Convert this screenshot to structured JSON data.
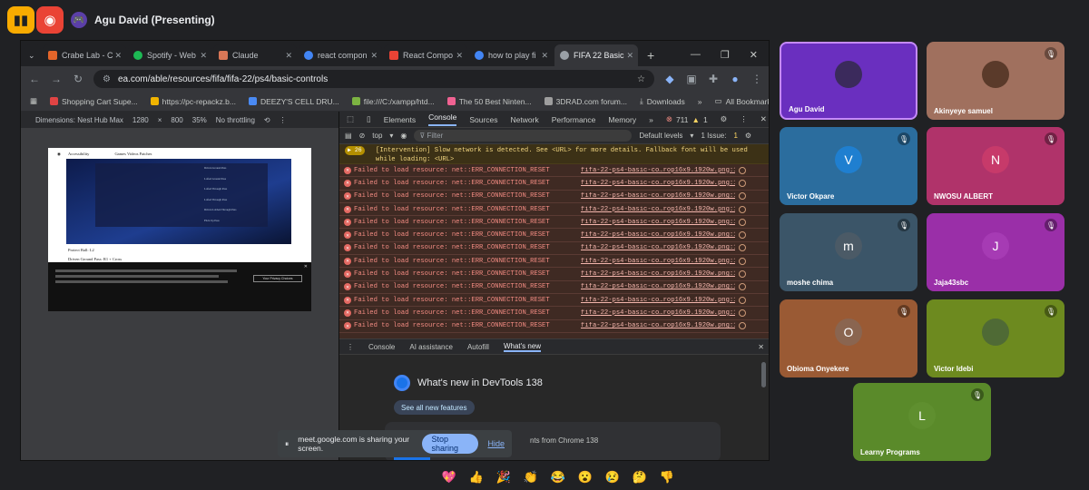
{
  "meet_top": {
    "presenter": "Agu David (Presenting)",
    "left_icon": "meet-panel-icon",
    "record_icon": "record-icon"
  },
  "browser": {
    "tabs": [
      {
        "label": "Crabe Lab - C",
        "color": "#e3652a"
      },
      {
        "label": "Spotify - Web",
        "color": "#1db954"
      },
      {
        "label": "Claude",
        "color": "#d97757"
      },
      {
        "label": "react compon",
        "color": "#4285f4"
      },
      {
        "label": "React Compo",
        "color": "#ea4335"
      },
      {
        "label": "how to play fi",
        "color": "#4285f4"
      },
      {
        "label": "FIFA 22 Basic",
        "color": "#9aa0a6"
      }
    ],
    "url": "ea.com/able/resources/fifa/fifa-22/ps4/basic-controls",
    "bookmarks": [
      {
        "label": "Shopping Cart Supe...",
        "color": "#e04444"
      },
      {
        "label": "https://pc-repackz.b...",
        "color": "#f0b400"
      },
      {
        "label": "DEEZY'S CELL DRU...",
        "color": "#4a8af4"
      },
      {
        "label": "file:///C:/xampp/htd...",
        "color": "#7cb342"
      },
      {
        "label": "The 50 Best Ninten...",
        "color": "#f06292"
      },
      {
        "label": "3DRAD.com forum...",
        "color": "#9e9e9e"
      },
      {
        "label": "Downloads",
        "color": "#9aa0a6"
      }
    ],
    "all_bookmarks": "All Bookmarks"
  },
  "device_toolbar": {
    "dimensions": "Dimensions: Nest Hub Max",
    "width": "1280",
    "height": "800",
    "zoom": "35%",
    "throttle": "No throttling"
  },
  "page_preview": {
    "site_label": "Accessibility",
    "nav": "Games   Videos   Patches",
    "lines": [
      "Protect Ball: L2",
      "Driven Ground Pass: R1 + Cross",
      "Lofted Ground Pass: Cross + Cross",
      "Lofted Through Pass: Triangle + Triangle"
    ],
    "banner_rows": [
      "Driven Ground Pass",
      "Lofted Ground Pass",
      "Lofted Through Pass",
      "Lofted Through Pass",
      "Driven Lobbed Through Pass",
      "Flick Up Pass"
    ],
    "cookie_button": "Your Privacy Choices"
  },
  "devtools": {
    "tabs": [
      "Elements",
      "Console",
      "Sources",
      "Network",
      "Performance",
      "Memory"
    ],
    "active_tab": "Console",
    "error_count": "711",
    "warn_count": "1",
    "context": "top",
    "filter_placeholder": "Filter",
    "levels": "Default levels",
    "issues": "1 Issue:",
    "issues_count": "1",
    "warning": {
      "count": "26",
      "line1": "[Intervention] Slow network is detected. See <URL> for more details. Fallback font will be used",
      "line2": "while loading: <URL>"
    },
    "error_message": "Failed to load resource: net::ERR_CONNECTION_RESET",
    "error_source": "fifa-22-ps4-basic-co…rop16x9.1920w.png:1",
    "drawer_tabs": [
      "Console",
      "AI assistance",
      "Autofill",
      "What's new"
    ],
    "whats_new_title": "What's new in DevTools 138",
    "see_all": "See all new features",
    "card_text": "nts from Chrome 138"
  },
  "sharing": {
    "notice": "meet.google.com is sharing your screen.",
    "stop": "Stop sharing",
    "hide": "Hide"
  },
  "participants": [
    {
      "name": "Agu David",
      "initial": "",
      "bg": "#6a2fbf",
      "av": "#3b2a5c",
      "muted": false
    },
    {
      "name": "Akinyeye samuel",
      "initial": "",
      "bg": "#a0705e",
      "av": "#5a3a2a",
      "muted": true
    },
    {
      "name": "Victor Okpare",
      "initial": "V",
      "bg": "#2b6d9e",
      "av": "#1f7fd0",
      "muted": true
    },
    {
      "name": "NWOSU ALBERT",
      "initial": "N",
      "bg": "#b0336a",
      "av": "#c73a6a",
      "muted": true
    },
    {
      "name": "moshe chima",
      "initial": "m",
      "bg": "#3b5568",
      "av": "#4b5a66",
      "muted": true
    },
    {
      "name": "Jaja43sbc",
      "initial": "J",
      "bg": "#9a2fa8",
      "av": "#a63bb4",
      "muted": true
    },
    {
      "name": "Obioma Onyekere",
      "initial": "O",
      "bg": "#9a5a34",
      "av": "#8a6550",
      "muted": true
    },
    {
      "name": "Victor Idebi",
      "initial": "",
      "bg": "#6d8a1f",
      "av": "#4f6a35",
      "muted": true
    },
    {
      "name": "Learny Programs",
      "initial": "L",
      "bg": "#5a8a2a",
      "av": "#5f8f2f",
      "muted": true
    }
  ],
  "reactions": [
    "💖",
    "👍",
    "🎉",
    "👏",
    "😂",
    "😮",
    "😢",
    "🤔",
    "👎"
  ]
}
